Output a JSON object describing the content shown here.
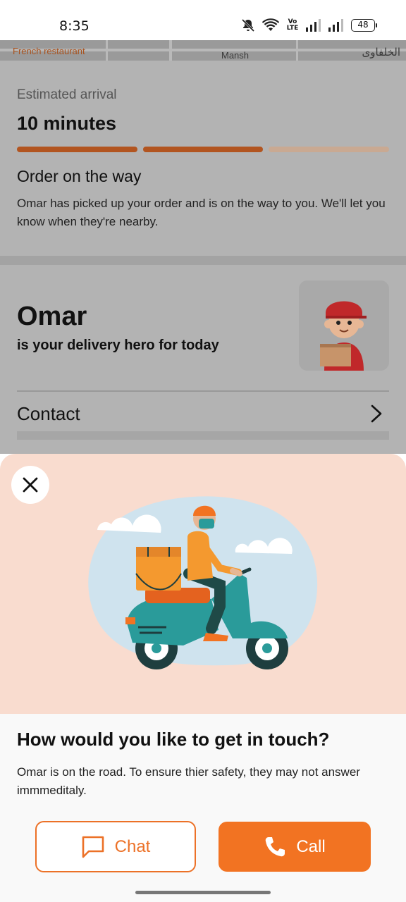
{
  "status_bar": {
    "time": "8:35",
    "battery": "48",
    "network_label": "Vo LTE",
    "icons": [
      "mute-bell-icon",
      "wifi-icon",
      "volte-icon",
      "signal-icon",
      "signal-icon",
      "battery-icon"
    ]
  },
  "map": {
    "label_left": "French restaurant",
    "label_mid": "Mansh",
    "label_right": "الخلفاوى"
  },
  "order": {
    "estimated_label": "Estimated arrival",
    "estimated_value": "10 minutes",
    "progress_segments": 3,
    "progress_completed": 2,
    "status_title": "Order on the way",
    "status_description": "Omar has picked up your order and is on the way to you. We'll let you know when they're nearby."
  },
  "hero": {
    "name": "Omar",
    "subtitle": "is your delivery hero for today",
    "contact_label": "Contact"
  },
  "sheet": {
    "title": "How would you like to get in touch?",
    "description": "Omar is on the road. To ensure thier safety, they may not answer immmeditaly.",
    "chat_label": "Chat",
    "call_label": "Call"
  },
  "colors": {
    "accent": "#f27322",
    "progress_done": "#b25520",
    "illustration_bg": "#f9dccf"
  }
}
